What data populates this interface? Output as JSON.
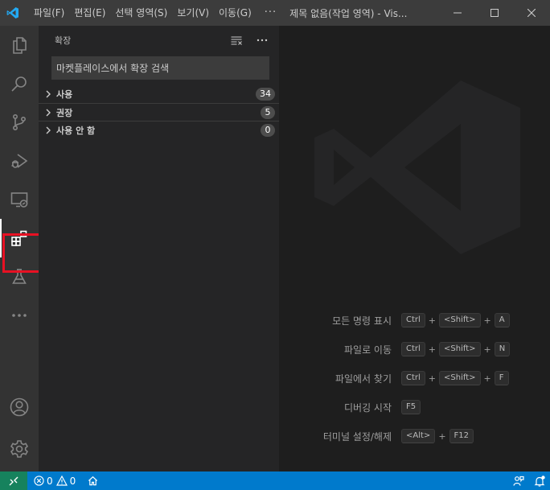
{
  "titlebar": {
    "menu": [
      "파일(F)",
      "편집(E)",
      "선택 영역(S)",
      "보기(V)",
      "이동(G)"
    ],
    "more": "···",
    "window_title": "제목 없음(작업 영역) - Vis..."
  },
  "sidebar": {
    "title": "확장",
    "search_placeholder": "마켓플레이스에서 확장 검색",
    "sections": [
      {
        "label": "사용",
        "count": "34"
      },
      {
        "label": "권장",
        "count": "5"
      },
      {
        "label": "사용 안 함",
        "count": "0"
      }
    ]
  },
  "shortcuts": [
    {
      "label": "모든 명령 표시",
      "keys": [
        "Ctrl",
        "<Shift>",
        "A"
      ]
    },
    {
      "label": "파일로 이동",
      "keys": [
        "Ctrl",
        "<Shift>",
        "N"
      ]
    },
    {
      "label": "파일에서 찾기",
      "keys": [
        "Ctrl",
        "<Shift>",
        "F"
      ]
    },
    {
      "label": "디버깅 시작",
      "keys": [
        "F5"
      ]
    },
    {
      "label": "터미널 설정/해제",
      "keys": [
        "<Alt>",
        "F12"
      ]
    }
  ],
  "statusbar": {
    "errors": "0",
    "warnings": "0"
  },
  "colors": {
    "accent": "#007acc",
    "remote": "#16825d",
    "highlight": "#e81123",
    "logo": "#23a9f2"
  },
  "icons": {
    "activity": [
      "files-icon",
      "search-icon",
      "source-control-icon",
      "run-debug-icon",
      "remote-explorer-icon",
      "extensions-icon",
      "testing-icon",
      "more-icon",
      "account-icon",
      "settings-gear-icon"
    ]
  }
}
